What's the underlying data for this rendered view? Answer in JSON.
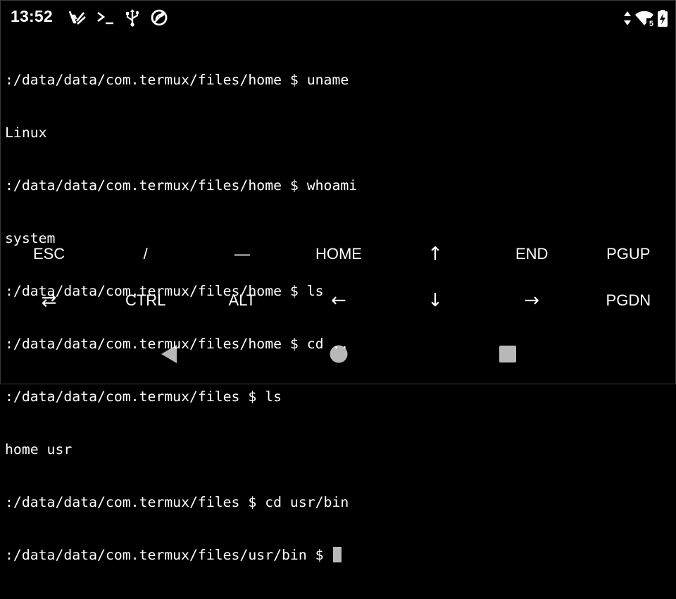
{
  "status_bar": {
    "time": "13:52",
    "left_icons": [
      "notification-icon",
      "terminal-icon",
      "usb-icon",
      "sync-disabled-icon"
    ],
    "right_icons": [
      "data-arrows-icon",
      "wifi-icon",
      "battery-charging-icon"
    ],
    "wifi_badge": "5"
  },
  "terminal": {
    "lines": [
      ":/data/data/com.termux/files/home $ uname",
      "Linux",
      ":/data/data/com.termux/files/home $ whoami",
      "system",
      ":/data/data/com.termux/files/home $ ls",
      ":/data/data/com.termux/files/home $ cd ..",
      ":/data/data/com.termux/files $ ls",
      "home usr",
      ":/data/data/com.termux/files $ cd usr/bin",
      ":/data/data/com.termux/files/usr/bin $ "
    ]
  },
  "extra_keys": {
    "row1": [
      "ESC",
      "/",
      "—",
      "HOME",
      "↑",
      "END",
      "PGUP"
    ],
    "row2": [
      "⇄",
      "CTRL",
      "ALT",
      "←",
      "↓",
      "→",
      "PGDN"
    ]
  },
  "nav_bar": {
    "buttons": [
      "back-icon",
      "home-icon",
      "recents-icon"
    ]
  },
  "colors": {
    "background": "#000000",
    "foreground": "#ffffff",
    "cursor": "#b8b8b8"
  }
}
